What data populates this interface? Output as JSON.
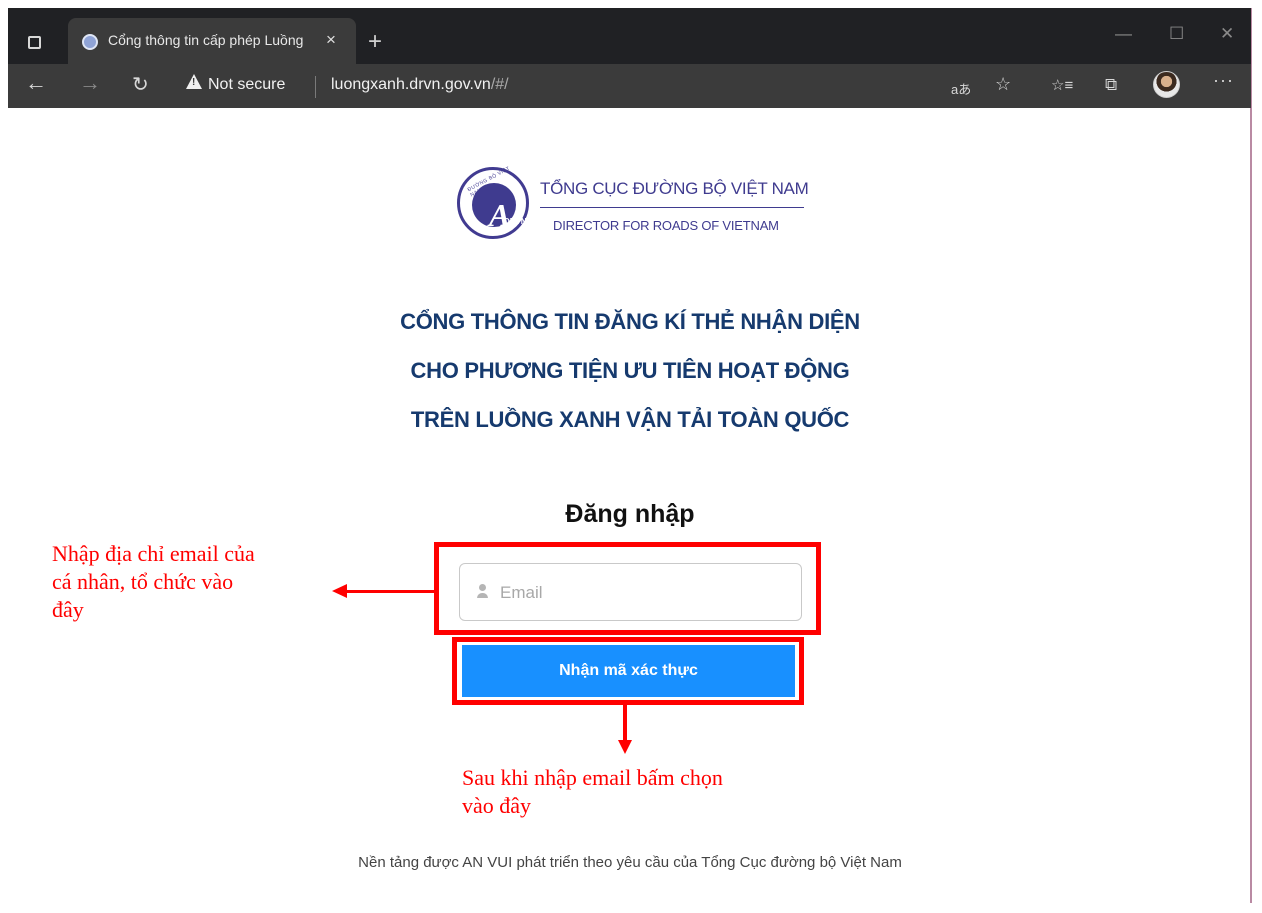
{
  "browser": {
    "tab_title": "Cổng thông tin cấp phép Luồng",
    "tab_close_glyph": "×",
    "new_tab_glyph": "+",
    "window_minimize_glyph": "—",
    "window_maximize_glyph": "☐",
    "window_close_glyph": "✕",
    "security_status": "Not secure",
    "url_host": "luongxanh.drvn.gov.vn",
    "url_path": "/#/",
    "icons": {
      "tab_actions": "tab-actions-icon",
      "back": "←",
      "forward": "→",
      "refresh": "↻",
      "read_aloud": "aあ",
      "add_favorite": "☆",
      "favorites": "☆≡",
      "collections": "⧉",
      "more": "···"
    }
  },
  "page": {
    "logo": {
      "primary": "TỔNG CỤC ĐƯỜNG BỘ VIỆT NAM",
      "secondary": "DIRECTOR FOR ROADS OF VIETNAM",
      "mark_text": "DRVN",
      "mark_letter": "A",
      "mark_arc": "ĐƯỜNG BỘ VIỆT NAM"
    },
    "headline": [
      "CỔNG THÔNG TIN ĐĂNG KÍ THẺ NHẬN DIỆN",
      "CHO PHƯƠNG TIỆN ƯU TIÊN HOẠT ĐỘNG",
      "TRÊN LUỒNG XANH VẬN TẢI TOÀN QUỐC"
    ],
    "login": {
      "title": "Đăng nhập",
      "email_placeholder": "Email",
      "email_value": "",
      "submit_label": "Nhận mã xác thực"
    },
    "footer": "Nền tảng được AN VUI phát triển theo yêu cầu của Tổng Cục đường bộ Việt Nam"
  },
  "annotations": {
    "email_note": [
      "Nhập địa chỉ email của",
      "cá nhân, tổ chức vào",
      "đây"
    ],
    "button_note": [
      "Sau khi nhập email bấm chọn",
      "vào đây"
    ],
    "color": "#ff0000"
  },
  "colors": {
    "headline": "#163a6e",
    "logo": "#3f3b8f",
    "button": "#1890ff",
    "chrome_dark": "#202124",
    "chrome_toolbar": "#3b3b3b"
  }
}
